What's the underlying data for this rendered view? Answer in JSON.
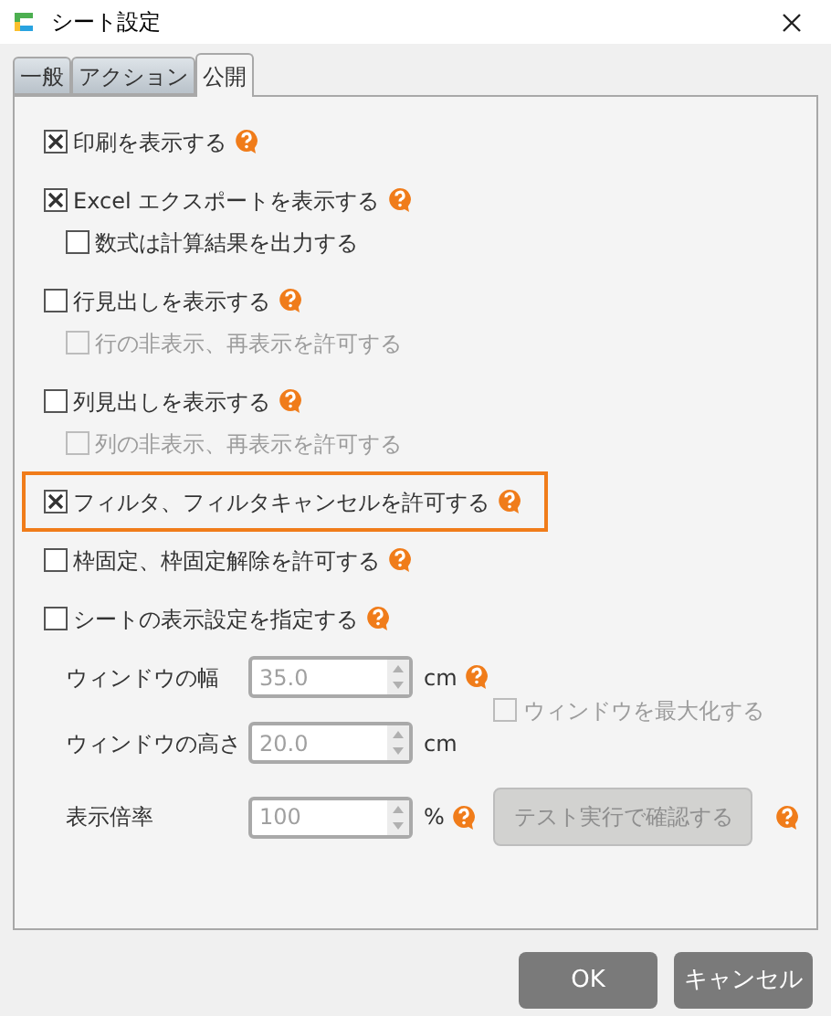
{
  "window": {
    "title": "シート設定"
  },
  "tabs": [
    {
      "label": "一般",
      "selected": false
    },
    {
      "label": "アクション",
      "selected": false
    },
    {
      "label": "公開",
      "selected": true
    }
  ],
  "options": [
    {
      "label": "印刷を表示する",
      "checked": true,
      "disabled": false,
      "help": true,
      "highlighted": false
    },
    {
      "label": "Excel エクスポートを表示する",
      "checked": true,
      "disabled": false,
      "help": true,
      "highlighted": false,
      "children": [
        {
          "label": "数式は計算結果を出力する",
          "checked": false,
          "disabled": false
        }
      ]
    },
    {
      "label": "行見出しを表示する",
      "checked": false,
      "disabled": false,
      "help": true,
      "highlighted": false,
      "children": [
        {
          "label": "行の非表示、再表示を許可する",
          "checked": false,
          "disabled": true
        }
      ]
    },
    {
      "label": "列見出しを表示する",
      "checked": false,
      "disabled": false,
      "help": true,
      "highlighted": false,
      "children": [
        {
          "label": "列の非表示、再表示を許可する",
          "checked": false,
          "disabled": true
        }
      ]
    },
    {
      "label": "フィルタ、フィルタキャンセルを許可する",
      "checked": true,
      "disabled": false,
      "help": true,
      "highlighted": true
    },
    {
      "label": "枠固定、枠固定解除を許可する",
      "checked": false,
      "disabled": false,
      "help": true,
      "highlighted": false
    },
    {
      "label": "シートの表示設定を指定する",
      "checked": false,
      "disabled": false,
      "help": true,
      "highlighted": false
    }
  ],
  "fields": [
    {
      "label": "ウィンドウの幅",
      "value": "35.0",
      "unit": "cm",
      "help": true,
      "disabled": true
    },
    {
      "label": "ウィンドウの高さ",
      "value": "20.0",
      "unit": "cm",
      "help": false,
      "disabled": true
    },
    {
      "label": "表示倍率",
      "value": "100",
      "unit": "%",
      "help": true,
      "disabled": true
    }
  ],
  "maximize": {
    "label": "ウィンドウを最大化する",
    "checked": false,
    "disabled": true
  },
  "test_button": {
    "label": "テスト実行で確認する",
    "disabled": true,
    "help": true
  },
  "buttons": [
    {
      "label": "OK"
    },
    {
      "label": "キャンセル"
    }
  ]
}
